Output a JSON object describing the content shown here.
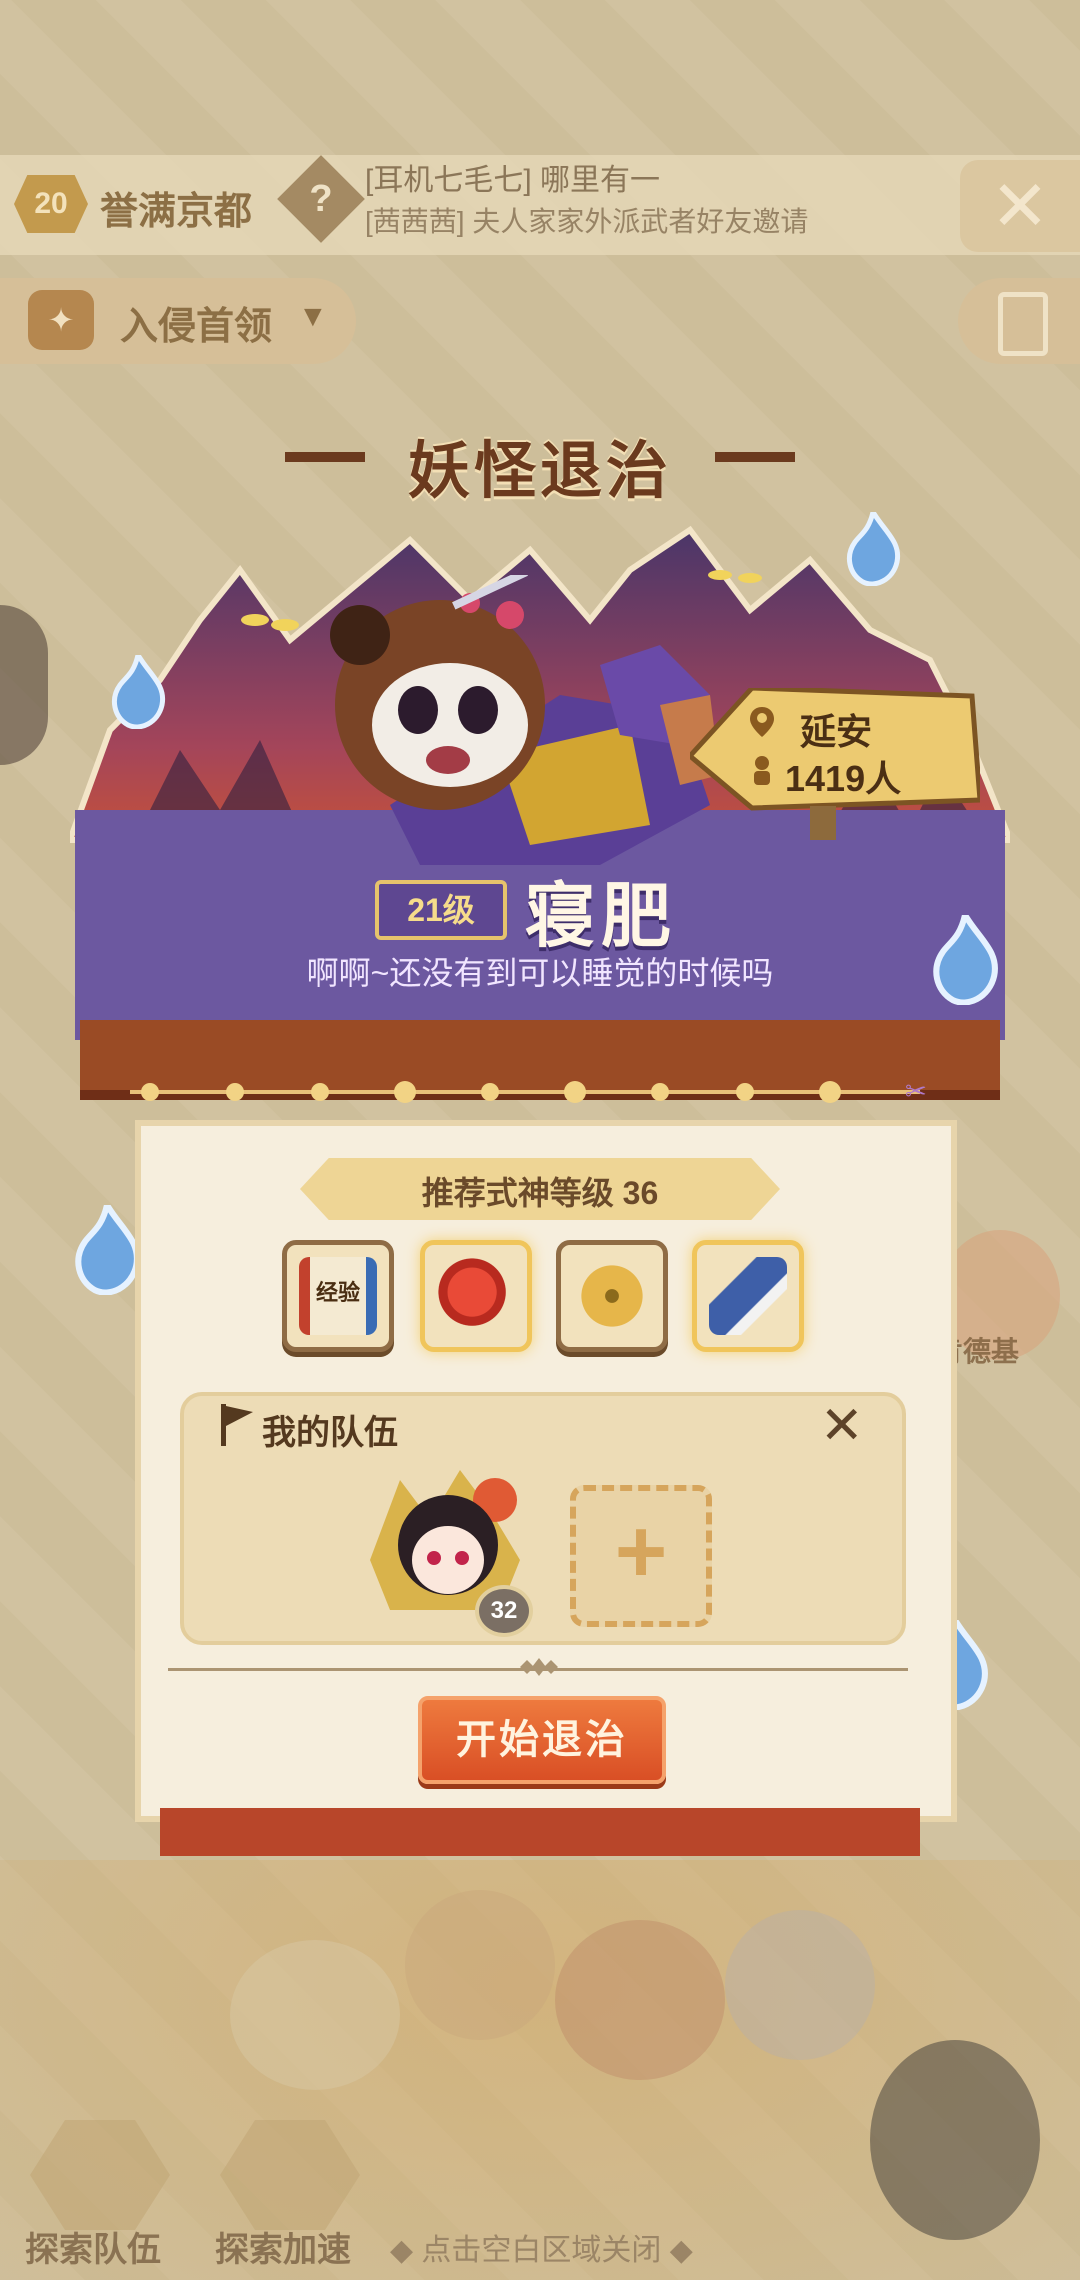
{
  "header": {
    "level_badge": "20",
    "region_name": "誉满京都",
    "help_icon": "?",
    "chat": {
      "line1": "[耳机七毛七] 哪里有一",
      "line2": "[茜茜茜] 夫人家家外派武者好友邀请"
    },
    "close_label": "✕"
  },
  "invade": {
    "label": "入侵首领",
    "arrow": "▼",
    "icon": "boss-icon"
  },
  "panel": {
    "title": "妖怪退治",
    "location": {
      "city": "延安",
      "count": "1419人"
    },
    "monster": {
      "level": "21级",
      "name": "寝肥",
      "quote": "啊啊~还没有到可以睡觉的时候吗"
    },
    "recommend": "推荐式神等级 36",
    "rewards": [
      {
        "name": "exp-scroll-icon",
        "label": "经验",
        "highlight": false
      },
      {
        "name": "magatama-icon",
        "label": "",
        "highlight": true
      },
      {
        "name": "coin-icon",
        "label": "",
        "highlight": false
      },
      {
        "name": "blue-bird-icon",
        "label": "",
        "highlight": true
      }
    ],
    "team": {
      "title": "我的队伍",
      "close": "✕",
      "member_level": "32",
      "add_symbol": "+"
    },
    "start_button": "开始退治"
  },
  "background": {
    "side_right_label": "肯德基"
  },
  "bottom": {
    "explore_team": "探索队伍",
    "explore_speed": "探索加速",
    "hint": "◆ 点击空白区域关闭 ◆"
  },
  "colors": {
    "banner_purple": "#6c58a0",
    "button_orange": "#e0602d",
    "frame_red": "#9a4b25"
  }
}
